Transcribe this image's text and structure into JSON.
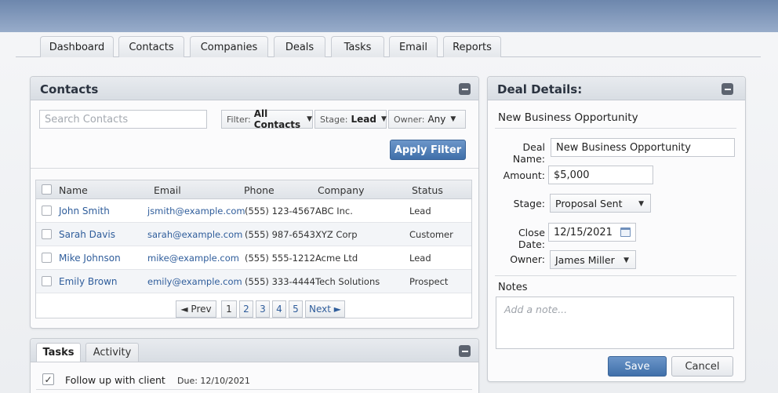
{
  "nav": {
    "tabs": [
      "Dashboard",
      "Contacts",
      "Companies",
      "Deals",
      "Tasks",
      "Email",
      "Reports"
    ]
  },
  "contacts": {
    "title": "Contacts",
    "search_placeholder": "Search Contacts",
    "filter_label": "Filter:",
    "filter_value": "All Contacts",
    "stage_label": "Stage:",
    "stage_value": "Lead",
    "owner_label": "Owner:",
    "owner_value": "Any",
    "apply_label": "Apply Filter",
    "columns": [
      "Name",
      "Email",
      "Phone",
      "Company",
      "Status"
    ],
    "rows": [
      {
        "name": "John Smith",
        "email": "jsmith@example.com",
        "phone": "(555) 123-4567",
        "company": "ABC Inc.",
        "status": "Lead"
      },
      {
        "name": "Sarah Davis",
        "email": "sarah@example.com",
        "phone": "(555) 987-6543",
        "company": "XYZ Corp",
        "status": "Customer"
      },
      {
        "name": "Mike Johnson",
        "email": "mike@example.com",
        "phone": "(555) 555-1212",
        "company": "Acme Ltd",
        "status": "Lead"
      },
      {
        "name": "Emily Brown",
        "email": "emily@example.com",
        "phone": "(555) 333-4444",
        "company": "Tech Solutions",
        "status": "Prospect"
      }
    ],
    "pagination": {
      "prev": "◄ Prev",
      "pages": [
        "1",
        "2",
        "3",
        "4",
        "5"
      ],
      "next": "Next ►"
    }
  },
  "tasks_panel": {
    "tabs": [
      "Tasks",
      "Activity"
    ],
    "items": [
      {
        "label": "Follow up with client",
        "due": "Due: 12/10/2021",
        "checked": true
      }
    ]
  },
  "deal": {
    "title": "Deal Details:",
    "heading": "New Business Opportunity",
    "name_label": "Deal Name:",
    "name_value": "New Business Opportunity",
    "amount_label": "Amount:",
    "amount_value": "$5,000",
    "stage_label": "Stage:",
    "stage_value": "Proposal Sent",
    "close_label": "Close Date:",
    "close_value": "12/15/2021",
    "owner_label": "Owner:",
    "owner_value": "James Miller",
    "notes_label": "Notes",
    "notes_placeholder": "Add a note...",
    "save_label": "Save",
    "cancel_label": "Cancel"
  },
  "colors": {
    "header_bar": "#7d95b8",
    "primary_button": "#4f7db8",
    "link": "#2f5d9b"
  }
}
